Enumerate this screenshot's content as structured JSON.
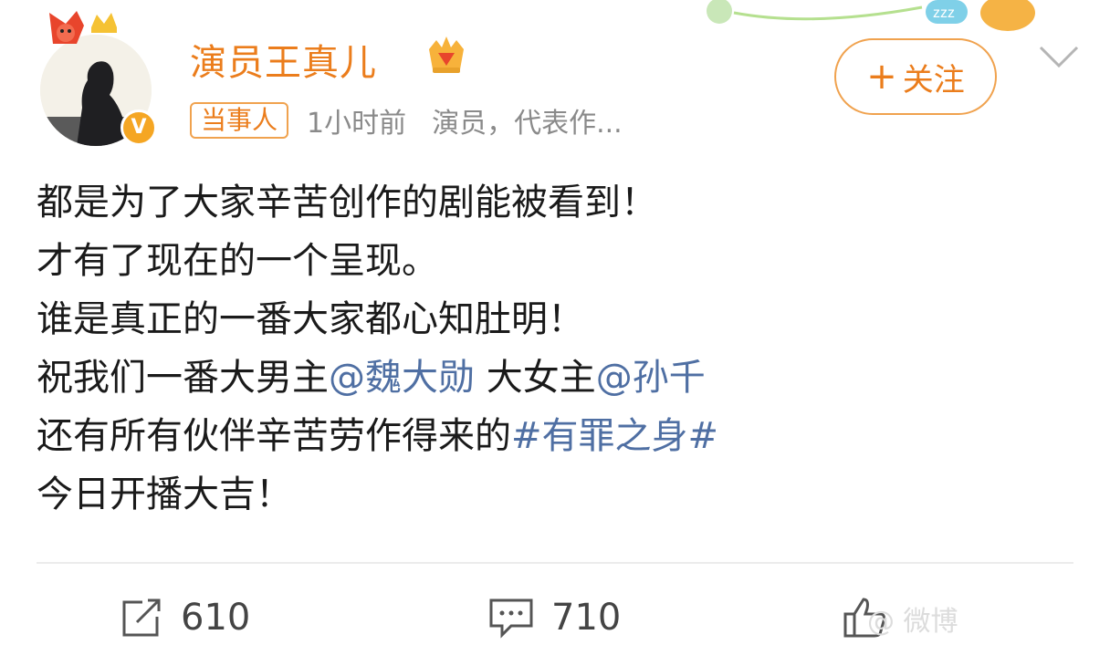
{
  "header": {
    "username": "演员王真儿",
    "tag": "当事人",
    "time": "1小时前",
    "bio": "演员，代表作..."
  },
  "follow": {
    "plus": "+",
    "label": "关注"
  },
  "post": {
    "lines": [
      [
        {
          "t": "都是为了大家辛苦创作的剧能被看到！"
        }
      ],
      [
        {
          "t": "才有了现在的一个呈现。"
        }
      ],
      [
        {
          "t": "谁是真正的一番大家都心知肚明！"
        }
      ],
      [
        {
          "t": "祝我们一番大男主"
        },
        {
          "t": "@魏大勋",
          "link": true
        },
        {
          "t": " 大女主"
        },
        {
          "t": "@孙千",
          "link": true
        }
      ],
      [
        {
          "t": "还有所有伙伴辛苦劳作得来的"
        },
        {
          "t": "#有罪之身#",
          "link": true
        }
      ],
      [
        {
          "t": "今日开播大吉！"
        }
      ]
    ]
  },
  "actions": {
    "repost_count": "610",
    "comment_count": "710"
  },
  "watermark": "@ 微博",
  "colors": {
    "accent": "#eb7d1c",
    "link": "#4f6fa3",
    "verified": "#f5a623"
  },
  "icons": [
    "fox-frame-icon",
    "crown-icon",
    "verified-icon",
    "chevron-down-icon",
    "repost-icon",
    "comment-icon",
    "like-icon"
  ]
}
